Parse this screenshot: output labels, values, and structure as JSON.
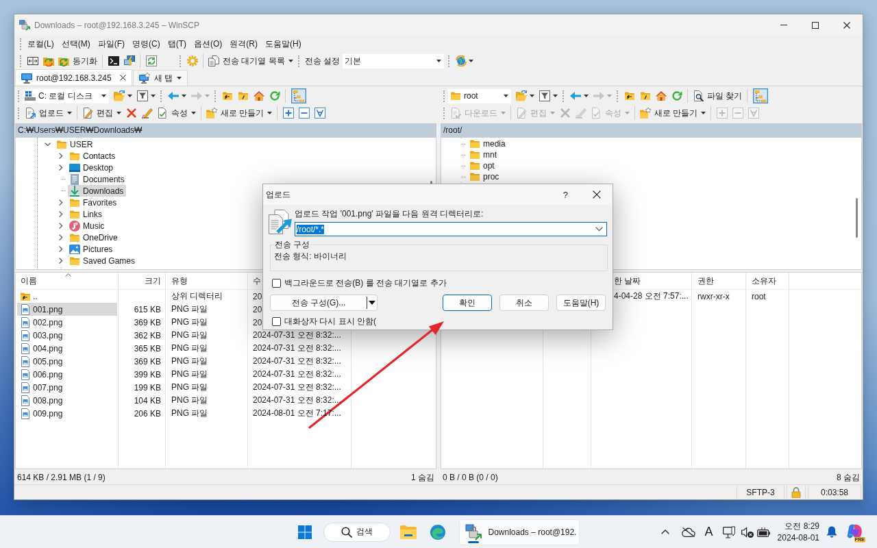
{
  "window": {
    "title": "Downloads – root@192.168.3.245 – WinSCP"
  },
  "menu": [
    "로컬(L)",
    "선택(M)",
    "파일(F)",
    "명령(C)",
    "탭(T)",
    "옵션(O)",
    "원격(R)",
    "도움말(H)"
  ],
  "toolbar": {
    "sync": "동기화",
    "queue": "전송 대기열 목록",
    "transfer_settings_label": "전송 설정",
    "transfer_settings_value": "기본"
  },
  "tabs": [
    {
      "kind": "session",
      "label": "root@192.168.3.245",
      "selected": true
    },
    {
      "kind": "new",
      "label": "새 탭",
      "selected": false
    }
  ],
  "panels": [
    {
      "location": {
        "kind": "drive",
        "label": "C: 로컬 디스크"
      },
      "forward_disabled": true,
      "tree_view_on": true,
      "actions": [
        {
          "kind": "upload",
          "label": "업로드",
          "disabled": false
        },
        {
          "kind": "edit",
          "label": "편집",
          "disabled": false
        },
        {
          "kind": "delete",
          "disabled": false
        },
        {
          "kind": "rename",
          "disabled": false
        },
        {
          "kind": "properties",
          "label": "속성",
          "disabled": false
        },
        {
          "kind": "new",
          "label": "새로 만들기",
          "disabled": false
        },
        {
          "kind": "select",
          "disabled": false
        },
        {
          "kind": "unselect",
          "disabled": false
        },
        {
          "kind": "filter",
          "disabled": false
        }
      ],
      "path": "C:₩Users₩USER₩Downloads₩",
      "tree": [
        {
          "kind": "folder",
          "label": "USER",
          "expandable": true,
          "expanded": true,
          "selected": false,
          "children": [
            {
              "kind": "folder",
              "label": "Contacts",
              "expandable": true,
              "expanded": false,
              "selected": false
            },
            {
              "kind": "desktop",
              "label": "Desktop",
              "expandable": true,
              "expanded": false,
              "selected": false
            },
            {
              "kind": "documents",
              "label": "Documents",
              "expandable": false,
              "expanded": false,
              "selected": false
            },
            {
              "kind": "downloads",
              "label": "Downloads",
              "expandable": false,
              "expanded": false,
              "selected": true
            },
            {
              "kind": "folder",
              "label": "Favorites",
              "expandable": true,
              "expanded": false,
              "selected": false
            },
            {
              "kind": "folder",
              "label": "Links",
              "expandable": true,
              "expanded": false,
              "selected": false
            },
            {
              "kind": "music",
              "label": "Music",
              "expandable": true,
              "expanded": false,
              "selected": false
            },
            {
              "kind": "folder",
              "label": "OneDrive",
              "expandable": true,
              "expanded": false,
              "selected": false
            },
            {
              "kind": "pictures",
              "label": "Pictures",
              "expandable": true,
              "expanded": false,
              "selected": false
            },
            {
              "kind": "folder",
              "label": "Saved Games",
              "expandable": true,
              "expanded": false,
              "selected": false
            }
          ]
        }
      ],
      "columns": [
        {
          "kind": "name",
          "label": "이름",
          "sorted": true
        },
        {
          "kind": "size",
          "label": "크기",
          "sorted": false
        },
        {
          "kind": "type",
          "label": "유형",
          "sorted": false
        },
        {
          "kind": "date",
          "label": "수",
          "sorted": false
        }
      ],
      "rows": [
        {
          "kind": "parent",
          "name": "..",
          "type": "상위 디렉터리",
          "date": "20",
          "selected": false
        },
        {
          "kind": "file",
          "name": "001.png",
          "size": "615 KB",
          "type": "PNG 파일",
          "date": "20",
          "selected": true
        },
        {
          "kind": "file",
          "name": "002.png",
          "size": "369 KB",
          "type": "PNG 파일",
          "date": "20",
          "selected": false
        },
        {
          "kind": "file",
          "name": "003.png",
          "size": "362 KB",
          "type": "PNG 파일",
          "date": "2024-07-31 오전 8:32:...",
          "selected": false
        },
        {
          "kind": "file",
          "name": "004.png",
          "size": "365 KB",
          "type": "PNG 파일",
          "date": "2024-07-31 오전 8:32:...",
          "selected": false
        },
        {
          "kind": "file",
          "name": "005.png",
          "size": "369 KB",
          "type": "PNG 파일",
          "date": "2024-07-31 오전 8:32:...",
          "selected": false
        },
        {
          "kind": "file",
          "name": "006.png",
          "size": "399 KB",
          "type": "PNG 파일",
          "date": "2024-07-31 오전 8:32:...",
          "selected": false
        },
        {
          "kind": "file",
          "name": "007.png",
          "size": "199 KB",
          "type": "PNG 파일",
          "date": "2024-07-31 오전 8:32:...",
          "selected": false
        },
        {
          "kind": "file",
          "name": "008.png",
          "size": "104 KB",
          "type": "PNG 파일",
          "date": "2024-07-31 오전 8:32:...",
          "selected": false
        },
        {
          "kind": "file",
          "name": "009.png",
          "size": "206 KB",
          "type": "PNG 파일",
          "date": "2024-08-01 오전 7:17:...",
          "selected": false
        }
      ],
      "summary": "614 KB / 2.91 MB (1 / 9)",
      "hidden": "1 숨김"
    },
    {
      "location": {
        "kind": "folder",
        "label": "root"
      },
      "find": "파일 찾기",
      "forward_disabled": true,
      "tree_view_on": true,
      "actions": [
        {
          "kind": "download",
          "label": "다운로드",
          "disabled": true
        },
        {
          "kind": "edit",
          "label": "편집",
          "disabled": true
        },
        {
          "kind": "delete",
          "disabled": true
        },
        {
          "kind": "rename",
          "disabled": true
        },
        {
          "kind": "properties",
          "label": "속성",
          "disabled": true
        },
        {
          "kind": "new",
          "label": "새로 만들기",
          "disabled": false
        },
        {
          "kind": "select",
          "disabled": true
        },
        {
          "kind": "unselect",
          "disabled": true
        },
        {
          "kind": "filter",
          "disabled": true
        }
      ],
      "path": "/root/",
      "tree": [
        {
          "kind": "folder",
          "label": "media",
          "expandable": false,
          "expanded": false,
          "selected": false
        },
        {
          "kind": "folder",
          "label": "mnt",
          "expandable": false,
          "expanded": false,
          "selected": false
        },
        {
          "kind": "folder",
          "label": "opt",
          "expandable": false,
          "expanded": false,
          "selected": false
        },
        {
          "kind": "folder",
          "label": "proc",
          "expandable": false,
          "expanded": false,
          "selected": false
        }
      ],
      "columns": [
        {
          "kind": "date",
          "label": "한 날짜"
        },
        {
          "kind": "rights",
          "label": "권한"
        },
        {
          "kind": "owner",
          "label": "소유자"
        }
      ],
      "rows": [
        {
          "date": "4-04-28 오전 7:57:...",
          "rights": "rwxr-xr-x",
          "owner": "root"
        }
      ],
      "summary": "0 B / 0 B (0 / 0)",
      "hidden": "8 숨김"
    }
  ],
  "dialog": {
    "title": "업로드",
    "help": "?",
    "prompt": "업로드 작업 '001.png' 파일을 다음 원격 디렉터리로:",
    "target": "/root/*.*",
    "target_selected": true,
    "group_title": "전송 구성",
    "group_text": "전송 형식: 바이너리",
    "options": [
      {
        "label": "백그라운드로 전송(B) 를 전송 대기열로 추가",
        "checked": false
      }
    ],
    "settings_button": "전송 구성(G)...",
    "buttons": [
      {
        "label": "확인",
        "default": true
      },
      {
        "label": "취소",
        "default": false
      },
      {
        "label": "도움말(H)",
        "default": false
      }
    ],
    "footer_option": {
      "label": "대화상자 다시 표시 안함(",
      "checked": false
    }
  },
  "status_bar": {
    "protocol": "SFTP-3",
    "secure": true,
    "elapsed": "0:03:58"
  },
  "taskbar": {
    "search": "검색",
    "apps": [
      {
        "kind": "explorer",
        "active": false
      },
      {
        "kind": "edge",
        "active": false
      },
      {
        "kind": "winscp",
        "label": "Downloads – root@192.",
        "active": true
      }
    ],
    "ime": "A",
    "time": "오전 8:29",
    "date": "2024-08-01",
    "copilot_badge": "PRE"
  }
}
